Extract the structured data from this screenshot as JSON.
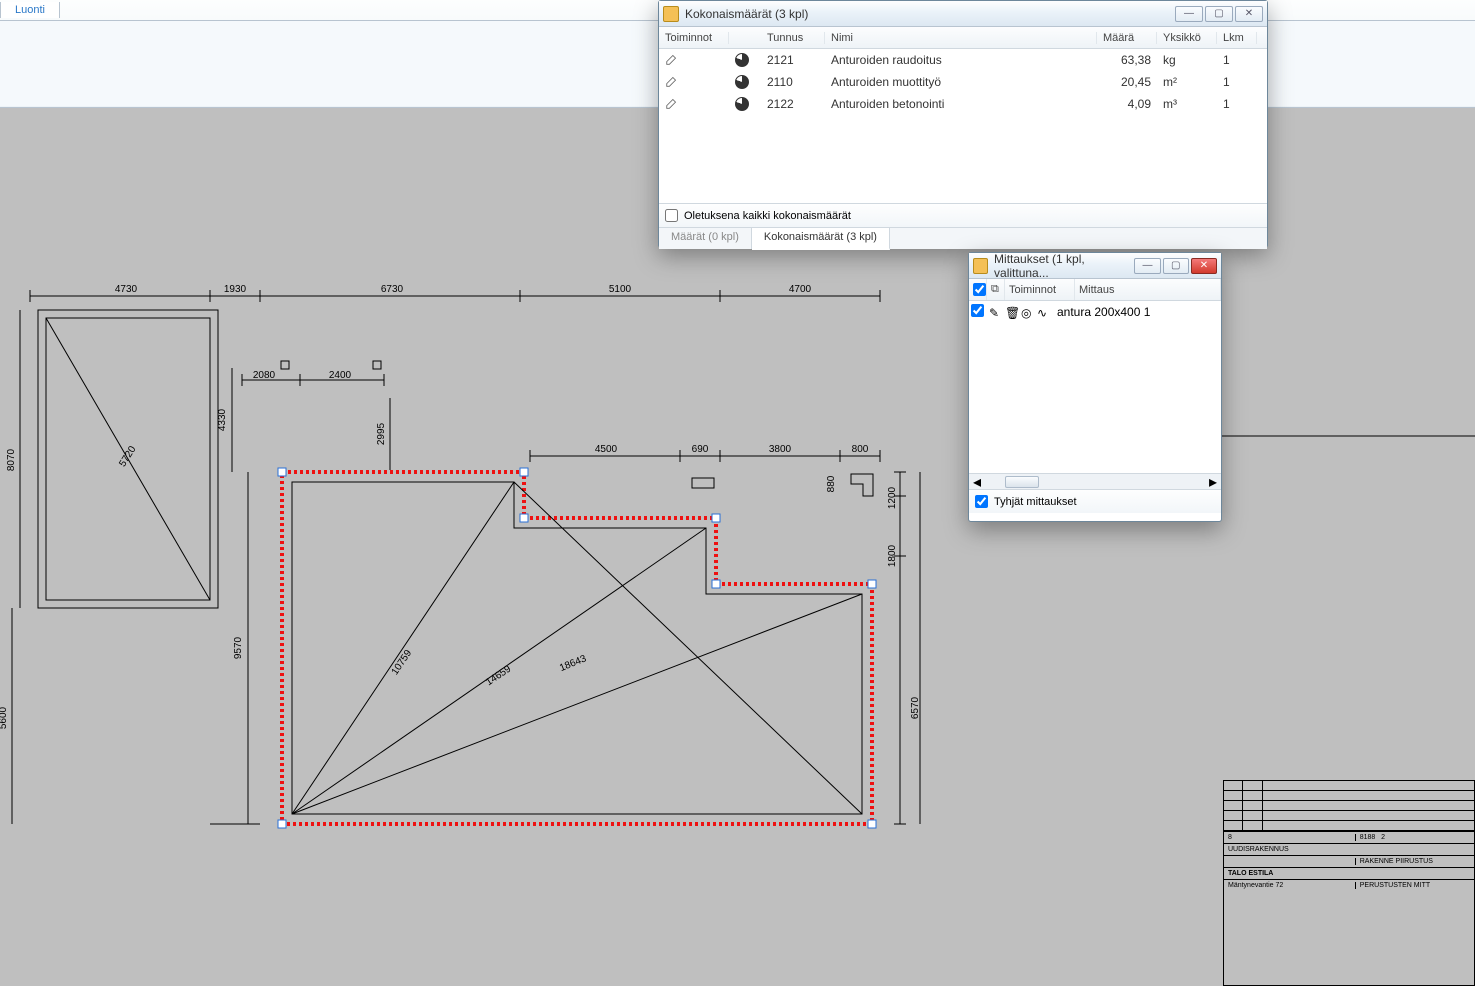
{
  "ribbon": {
    "tab_luonti": "Luonti"
  },
  "koko_win": {
    "title": "Kokonaismäärät (3 kpl)",
    "headers": {
      "toiminnot": "Toiminnot",
      "tunnus": "Tunnus",
      "nimi": "Nimi",
      "maara": "Määrä",
      "yksikko": "Yksikkö",
      "lkm": "Lkm"
    },
    "rows": [
      {
        "tunnus": "2121",
        "nimi": "Anturoiden raudoitus",
        "maara": "63,38",
        "yksikko": "kg",
        "lkm": "1"
      },
      {
        "tunnus": "2110",
        "nimi": "Anturoiden muottityö",
        "maara": "20,45",
        "yksikko": "m²",
        "lkm": "1"
      },
      {
        "tunnus": "2122",
        "nimi": "Anturoiden betonointi",
        "maara": "4,09",
        "yksikko": "m³",
        "lkm": "1"
      }
    ],
    "checkbox_label": "Oletuksena kaikki kokonaismäärät",
    "tab1": "Määrät (0 kpl)",
    "tab2": "Kokonaismäärät (3 kpl)"
  },
  "mitt_win": {
    "title": "Mittaukset (1 kpl, valittuna...",
    "header_toiminnot": "Toiminnot",
    "header_mittaus": "Mittaus",
    "row1": "antura 200x400 1",
    "footer_label": "Tyhjät mittaukset"
  },
  "dims": {
    "top": {
      "d1": "4730",
      "d2": "1930",
      "d3": "6730",
      "d4": "5100",
      "d5": "4700"
    },
    "rect_left": {
      "diag": "5720"
    },
    "mid": {
      "v_4330": "4330",
      "h_2080": "2080",
      "h_2400": "2400",
      "v_2995": "2995"
    },
    "inner_top": {
      "d4500": "4500",
      "d690": "690",
      "d3800": "3800",
      "d800": "800"
    },
    "right": {
      "v880": "880",
      "v1200": "1200",
      "v1800": "1800",
      "v6500": "6570"
    },
    "left": {
      "v8000": "8070",
      "v5600": "5600",
      "v9520": "9570"
    },
    "diags": {
      "d1": "10759",
      "d2": "14659",
      "d3": "18643"
    }
  },
  "titleblock": {
    "row_kohde": "UUDISRAKENNUS",
    "row_talo": "TALO ESTILA",
    "row_addr": "Mäntynevantie 72",
    "scale_a": "8",
    "scale_b": "8188",
    "scale_c": "2",
    "type": "RAKENNE PIIRUSTUS",
    "sheet": "PERUSTUSTEN MITT"
  }
}
